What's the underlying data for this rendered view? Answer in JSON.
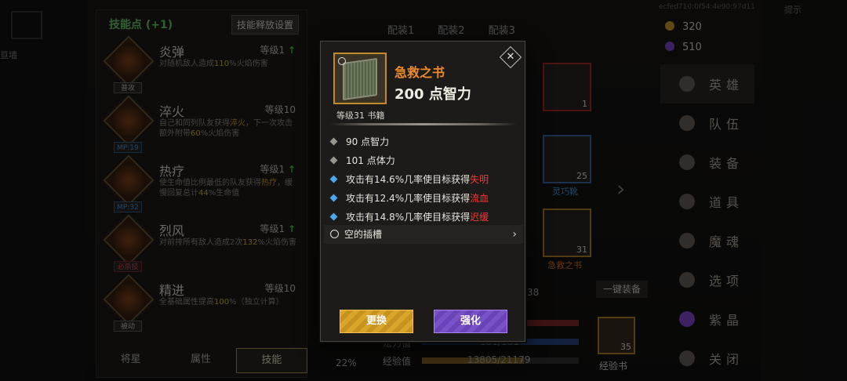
{
  "background": {
    "left_label": "亘墙",
    "skill_panel": {
      "points_label": "技能点 (+1)",
      "release_settings_button": "技能释放设置",
      "skills": [
        {
          "name": "炎弹",
          "level": "等级1",
          "tag": "普攻",
          "desc_pre": "对随机敌人造成",
          "desc_hl": "110",
          "desc_post": "%火焰伤害"
        },
        {
          "name": "淬火",
          "level": "等级10",
          "tag": "MP:19",
          "desc_pre": "自己和同列队友获得",
          "desc_hl": "淬火",
          "desc_post": "，下一次攻击额外附带",
          "desc_hl2": "60",
          "desc_post2": "%火焰伤害"
        },
        {
          "name": "热疗",
          "level": "等级1",
          "tag": "MP:32",
          "desc_pre": "使生命值比例最低的队友获得",
          "desc_hl": "热疗",
          "desc_post": "，缓慢回复总计",
          "desc_hl2": "44",
          "desc_post2": "%生命值"
        },
        {
          "name": "烈风",
          "level": "等级1",
          "tag": "必杀技",
          "desc_pre": "对前排所有敌人造成2次",
          "desc_hl": "132",
          "desc_post": "%火焰伤害"
        },
        {
          "name": "精进",
          "level": "等级10",
          "tag": "被动",
          "desc_pre": "全基础属性提高",
          "desc_hl": "100",
          "desc_post": "%（独立计算）"
        }
      ],
      "tabs": [
        "将星",
        "属性",
        "技能"
      ]
    },
    "loadouts": [
      "配装1",
      "配装2",
      "配装3"
    ],
    "slots": [
      {
        "count": "1"
      },
      {
        "count": "25",
        "label": "灵巧靴"
      },
      {
        "count": "31",
        "label": "急救之书"
      }
    ],
    "bars": {
      "row1_value": "38",
      "mp_label": "法力值",
      "mp_value": "181/181",
      "exp_label": "经验值",
      "exp_value": "13805/21179",
      "percent": "22%"
    },
    "one_click_equip": "一键装备",
    "exp_book": {
      "count": "35",
      "label": "经验书"
    },
    "resources": {
      "gold": "320",
      "gems": "510",
      "code": "ecfed710:0f54:4e90:97d11",
      "right_top": "提示"
    },
    "menu": [
      "英雄",
      "队伍",
      "装备",
      "道具",
      "魔魂",
      "选项",
      "紫晶",
      "关闭"
    ]
  },
  "item_popup": {
    "name": "急救之书",
    "main_stat": "200 点智力",
    "level_type": "等级31 书籍",
    "base_stats": [
      "90 点智力",
      "101 点体力"
    ],
    "effects": [
      {
        "text": "攻击有14.6%几率使目标获得",
        "status": "失明"
      },
      {
        "text": "攻击有12.4%几率使目标获得",
        "status": "流血"
      },
      {
        "text": "攻击有14.8%几率使目标获得",
        "status": "迟缓"
      }
    ],
    "socket_label": "空的插槽",
    "swap_button": "更换",
    "upgrade_button": "强化",
    "colors": {
      "name": "#ec8a2a",
      "status": "#f03a3a",
      "effect_bullet": "#4aa8f0",
      "swap": "#d9a52a",
      "upgrade": "#7a52c8"
    }
  }
}
